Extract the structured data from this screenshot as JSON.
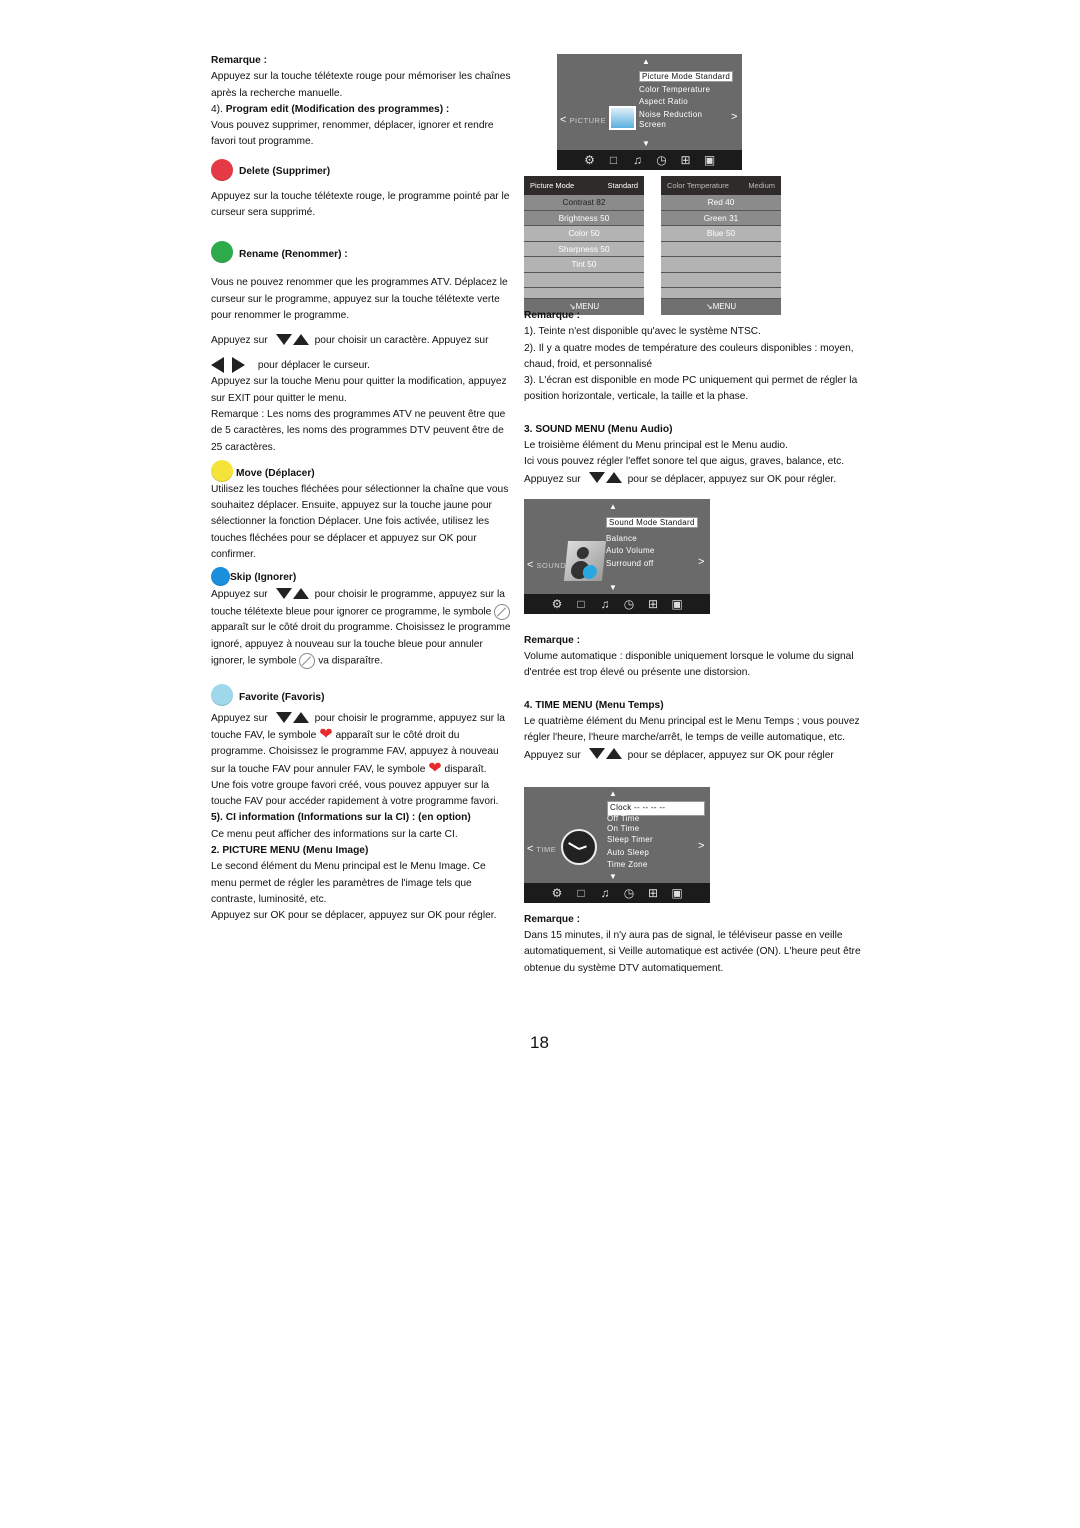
{
  "left": {
    "remarque_title": "Remarque :",
    "remarque_text": "Appuyez sur la touche télétexte rouge pour mémoriser les chaînes après la recherche manuelle.",
    "program_edit_prefix": "4). ",
    "program_edit_title": "Program edit (Modification des programmes) :",
    "program_edit_text": "Vous pouvez supprimer, renommer, déplacer, ignorer et rendre favori tout programme.",
    "delete": {
      "color": "#e63946",
      "title": "Delete (Supprimer)",
      "text": "Appuyez sur la touche télétexte rouge, le programme pointé par le curseur sera supprimé."
    },
    "rename": {
      "color": "#2daa4a",
      "title": "Rename (Renommer) :",
      "text1": "Vous ne pouvez renommer que les programmes ATV. Déplacez le curseur sur le programme, appuyez sur la touche télétexte verte pour renommer le programme.",
      "appuyez_sur": "Appuyez sur",
      "choose_char": "pour choisir un caractère. Appuyez sur",
      "move_cursor": "pour déplacer le curseur.",
      "text2": "Appuyez sur la touche Menu pour quitter la modification, appuyez sur EXIT pour quitter le menu.",
      "text3": "Remarque : Les noms des programmes ATV ne peuvent être que de 5 caractères, les noms des programmes DTV peuvent être de 25 caractères."
    },
    "move": {
      "color": "#f5e33a",
      "title": "Move (Déplacer)",
      "text": "Utilisez les touches fléchées pour sélectionner la chaîne que vous souhaitez déplacer. Ensuite, appuyez sur la touche jaune pour sélectionner la fonction Déplacer. Une fois activée, utilisez les touches fléchées pour se déplacer et appuyez sur OK pour confirmer."
    },
    "skip": {
      "color": "#1a8fdc",
      "title": "Skip (Ignorer)",
      "appuyez_sur": "Appuyez sur",
      "t1": "pour choisir le programme, appuyez sur la touche télétexte bleue pour ignorer ce programme, le symbole",
      "t2": "apparaît sur le côté droit du programme. Choisissez le programme ignoré, appuyez à nouveau sur la touche bleue pour annuler ignorer, le symbole",
      "t3": "va disparaître."
    },
    "favorite": {
      "color": "#9fd8ea",
      "title": "Favorite (Favoris)",
      "appuyez_sur": "Appuyez sur",
      "t1": "pour choisir le programme, appuyez sur la touche FAV, le symbole",
      "t2": "apparaît sur le côté droit du programme. Choisissez le programme FAV, appuyez à nouveau sur la touche FAV pour annuler FAV, le symbole",
      "t3": "disparaît.",
      "t4": "Une fois votre groupe favori créé, vous pouvez appuyer sur la touche FAV pour accéder rapidement à votre programme favori."
    },
    "ci_title": "5). CI information (Informations sur la CI) : (en option)",
    "ci_text": "Ce menu peut afficher des informations sur la carte CI.",
    "picture_title": "2. PICTURE MENU (Menu Image)",
    "picture_text1": "Le second élément du Menu principal est le Menu Image. Ce menu permet de régler les paramètres de l'image tels que contraste, luminosité, etc.",
    "picture_text2": "Appuyez sur OK pour se déplacer, appuyez sur OK pour régler."
  },
  "picture_menu": {
    "side_label": "PICTURE",
    "items": [
      "Picture Mode Standard",
      "Color Temperature",
      "Aspect Ratio",
      "Noise Reduction",
      "Screen"
    ]
  },
  "picture_mode_panel": {
    "head_left": "Picture Mode",
    "head_right": "Standard",
    "rows": [
      "Contrast 82",
      "Brightness 50",
      "Color 50",
      "Sharpness 50",
      "Tint 50",
      ""
    ],
    "footer": "MENU"
  },
  "color_temp_panel": {
    "head_left": "Color Temperature",
    "head_right": "Medium",
    "rows": [
      "Red 40",
      "Green 31",
      "Blue 50",
      "",
      "",
      ""
    ],
    "footer": "MENU"
  },
  "right": {
    "remarque1_title": "Remarque :",
    "remarque1_lines": [
      "1). Teinte n'est disponible qu'avec le système NTSC.",
      "2). Il y a quatre modes de température des couleurs disponibles : moyen, chaud, froid, et personnalisé",
      "3). L'écran est disponible en mode PC uniquement qui permet de régler la position horizontale, verticale, la taille et la phase."
    ],
    "sound_title": "3. SOUND MENU (Menu Audio)",
    "sound_text1": "Le troisième élément du Menu principal est le Menu audio.",
    "sound_text2": "Ici vous pouvez régler l'effet sonore tel que aigus, graves, balance, etc.",
    "sound_appuyez": "Appuyez sur",
    "sound_text3": "pour se déplacer, appuyez sur OK pour régler.",
    "remarque2_title": "Remarque :",
    "remarque2_text": "Volume automatique : disponible uniquement lorsque le volume du signal d'entrée est trop élevé ou présente une distorsion.",
    "time_title": "4. TIME MENU (Menu Temps)",
    "time_text1": "Le quatrième élément du Menu principal est le Menu Temps ; vous pouvez régler l'heure, l'heure marche/arrêt, le temps de veille automatique, etc. Appuyez sur",
    "time_text2": "pour se déplacer, appuyez sur OK pour régler",
    "remarque3_title": "Remarque :",
    "remarque3_text": "Dans 15 minutes, il n'y aura pas de signal, le téléviseur passe en veille automatiquement, si Veille automatique est activée (ON). L'heure peut être obtenue du système    DTV automatiquement."
  },
  "sound_menu": {
    "side_label": "SOUND",
    "items": [
      "Sound Mode Standard",
      "Balance",
      "Auto Volume",
      "Surround off"
    ]
  },
  "time_menu": {
    "side_label": "TIME",
    "items": [
      "Clock --   --   --   --",
      "Off Time",
      "On Time",
      "Sleep Timer",
      "Auto Sleep",
      "Time Zone"
    ]
  },
  "menu_bar_icons": [
    "gear-icon",
    "monitor-icon",
    "music-icon",
    "clock-icon",
    "grid-icon",
    "lock-icon"
  ],
  "page_number": "18"
}
